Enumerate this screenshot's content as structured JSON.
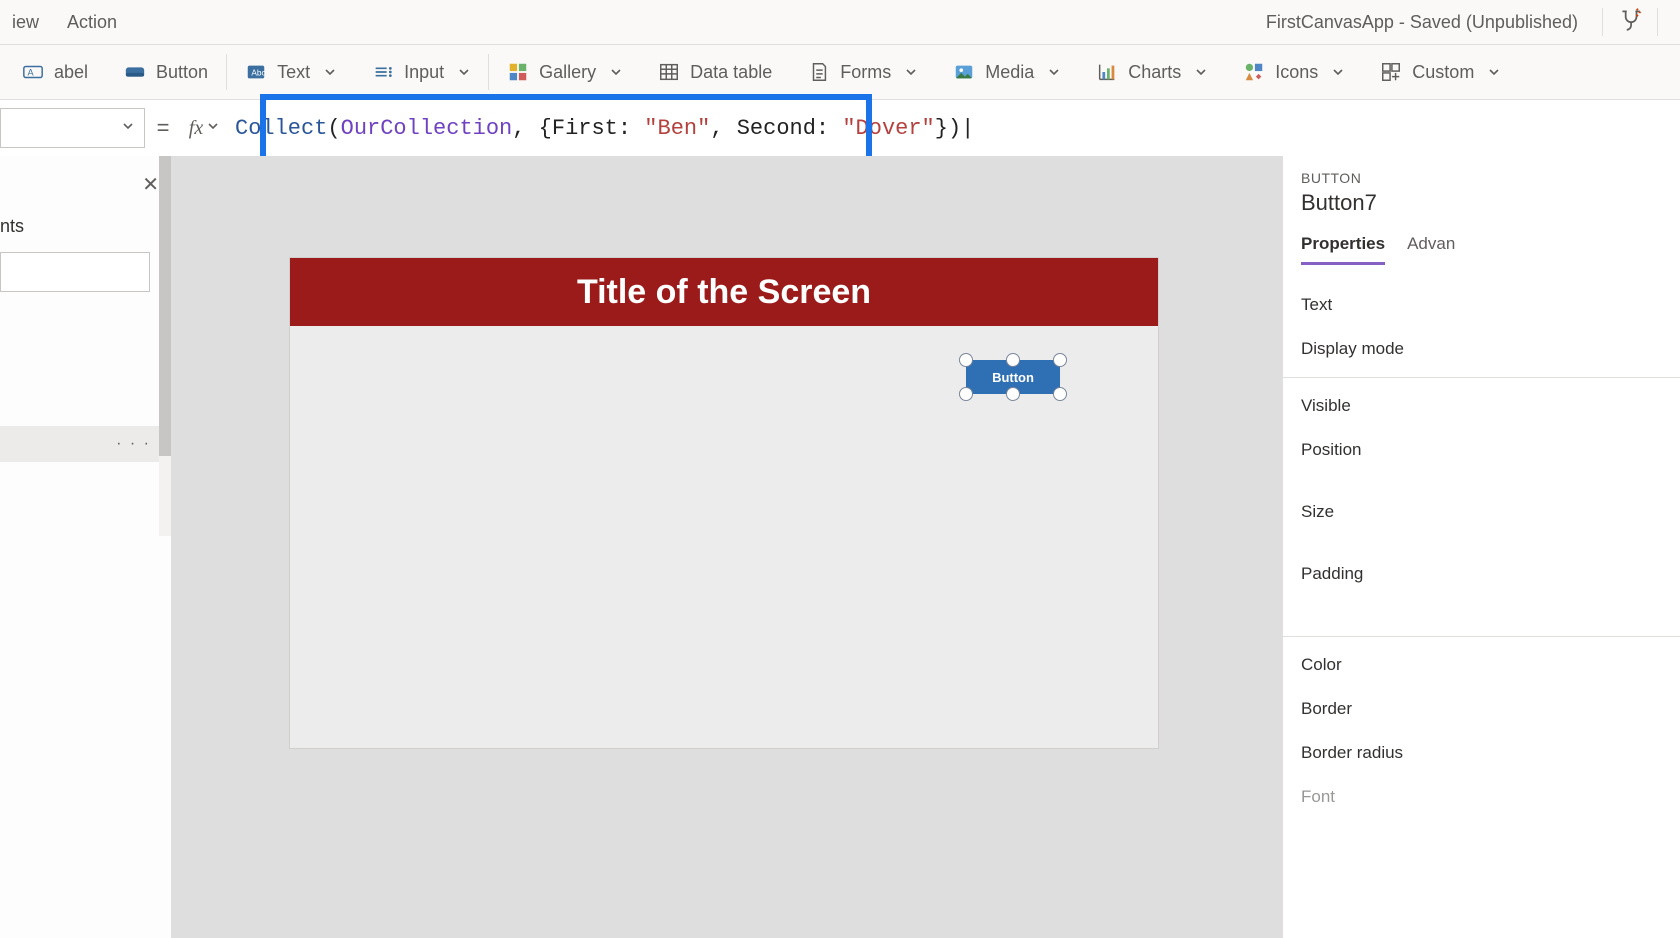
{
  "menubar": {
    "view": "iew",
    "action": "Action",
    "app_title": "FirstCanvasApp - Saved (Unpublished)"
  },
  "ribbon": {
    "label": "abel",
    "button": "Button",
    "text": "Text",
    "input": "Input",
    "gallery": "Gallery",
    "datatable": "Data table",
    "forms": "Forms",
    "media": "Media",
    "charts": "Charts",
    "icons": "Icons",
    "custom": "Custom"
  },
  "formula": {
    "eq": "=",
    "fx": "fx",
    "fn": "Collect",
    "open_paren": "(",
    "coll": "OurCollection",
    "mid1": ", {First: ",
    "str1": "\"Ben\"",
    "mid2": ", Second: ",
    "str2": "\"Dover\"",
    "tail": "})",
    "caret": "|"
  },
  "tree": {
    "close": "✕",
    "heading": "nts",
    "selected_more": "· · ·"
  },
  "canvas": {
    "screen_title": "Title of the Screen",
    "button_text": "Button"
  },
  "props": {
    "type": "BUTTON",
    "name": "Button7",
    "tabs": {
      "properties": "Properties",
      "advanced": "Advan"
    },
    "items": {
      "text": "Text",
      "display_mode": "Display mode",
      "visible": "Visible",
      "position": "Position",
      "size": "Size",
      "padding": "Padding",
      "color": "Color",
      "border": "Border",
      "border_radius": "Border radius",
      "font": "Font"
    }
  }
}
